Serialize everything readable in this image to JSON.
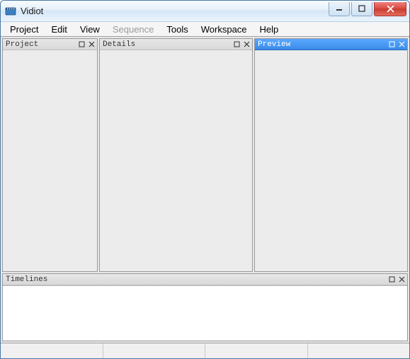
{
  "window": {
    "title": "Vidiot"
  },
  "menubar": {
    "items": [
      {
        "label": "Project",
        "enabled": true
      },
      {
        "label": "Edit",
        "enabled": true
      },
      {
        "label": "View",
        "enabled": true
      },
      {
        "label": "Sequence",
        "enabled": false
      },
      {
        "label": "Tools",
        "enabled": true
      },
      {
        "label": "Workspace",
        "enabled": true
      },
      {
        "label": "Help",
        "enabled": true
      }
    ]
  },
  "panels": {
    "project": {
      "title": "Project",
      "active": false
    },
    "details": {
      "title": "Details",
      "active": false
    },
    "preview": {
      "title": "Preview",
      "active": true
    },
    "timelines": {
      "title": "Timelines",
      "active": false
    }
  },
  "statusbar": {
    "cells": [
      "",
      "",
      "",
      ""
    ]
  }
}
